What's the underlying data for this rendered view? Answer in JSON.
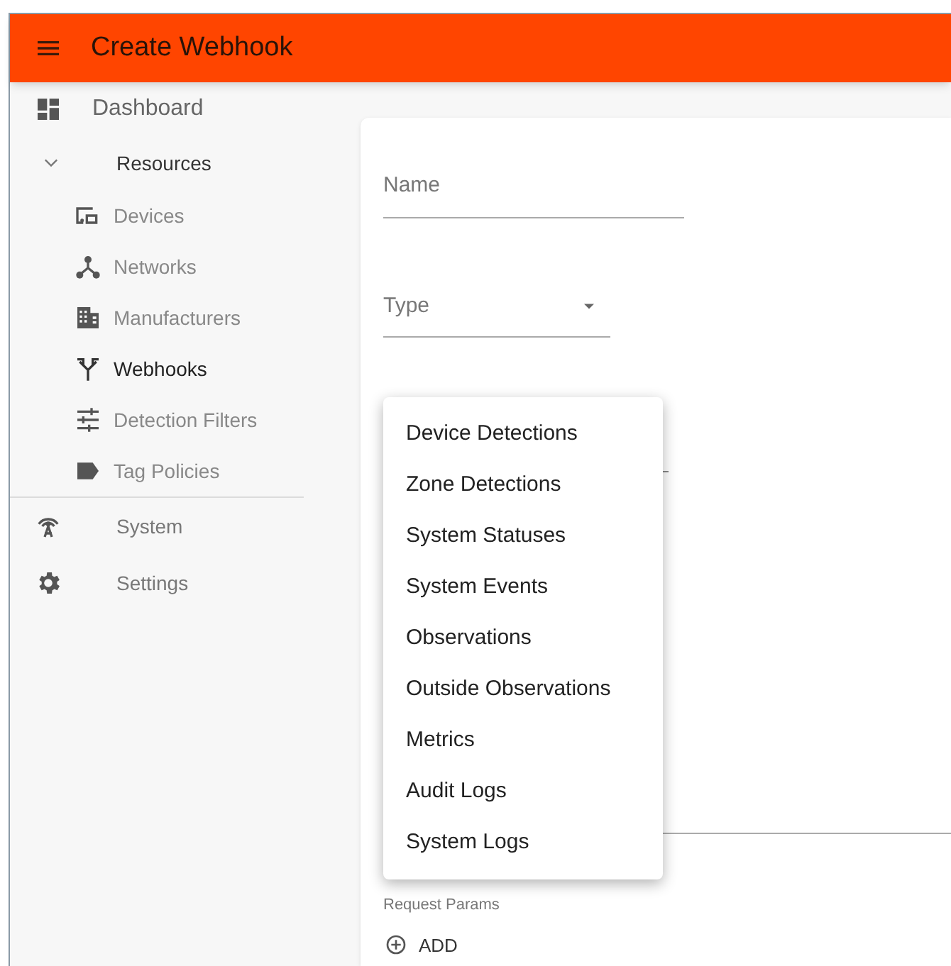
{
  "header": {
    "title": "Create Webhook"
  },
  "nav": [
    {
      "label": "Dashboard",
      "kind": "top"
    },
    {
      "label": "Resources",
      "kind": "group",
      "expanded": true,
      "children": [
        {
          "label": "Devices",
          "selected": false
        },
        {
          "label": "Networks",
          "selected": false
        },
        {
          "label": "Manufacturers",
          "selected": false
        },
        {
          "label": "Webhooks",
          "selected": true
        },
        {
          "label": "Detection Filters",
          "selected": false
        },
        {
          "label": "Tag Policies",
          "selected": false
        }
      ]
    },
    {
      "label": "System",
      "kind": "item"
    },
    {
      "label": "Settings",
      "kind": "item"
    }
  ],
  "form": {
    "name_field": {
      "placeholder": "Name"
    },
    "type_field": {
      "placeholder": "Type"
    },
    "type_menu": [
      "Device Detections",
      "Zone Detections",
      "System Statuses",
      "System Events",
      "Observations",
      "Outside Observations",
      "Metrics",
      "Audit Logs",
      "System Logs"
    ],
    "request_params": {
      "label": "Request Params",
      "add_button": "ADD"
    }
  }
}
